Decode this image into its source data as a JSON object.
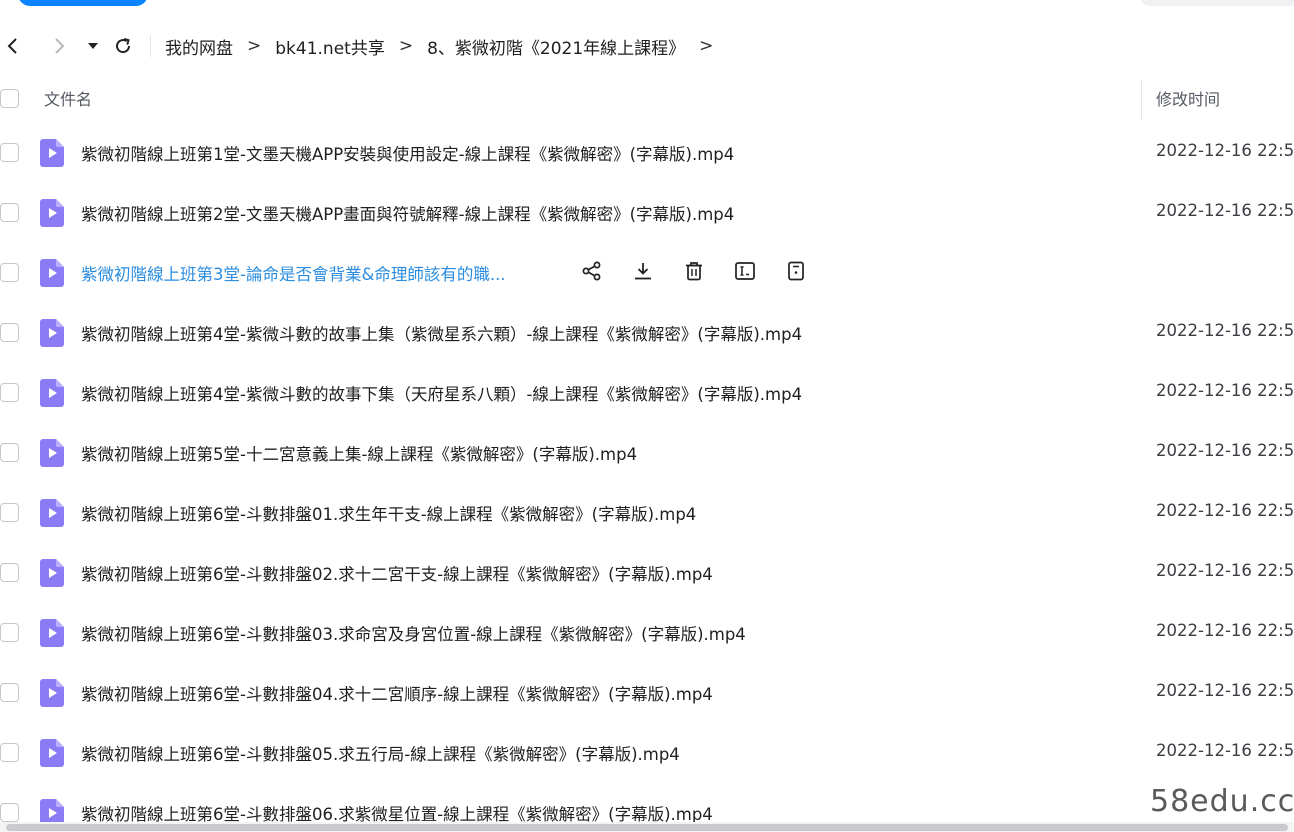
{
  "navigation": {
    "back_icon": "chevron-left-icon",
    "forward_icon": "chevron-right-icon",
    "history_icon": "caret-down-icon",
    "refresh_icon": "refresh-icon",
    "breadcrumbs": [
      "我的网盘",
      "bk41.net共享",
      "8、紫微初階《2021年線上課程》"
    ],
    "separator": ">"
  },
  "table": {
    "column_name": "文件名",
    "column_modified": "修改时间",
    "rows": [
      {
        "name": "紫微初階線上班第1堂-文墨天機APP安裝與使用設定-線上課程《紫微解密》(字幕版).mp4",
        "modified": "2022-12-16 22:5"
      },
      {
        "name": "紫微初階線上班第2堂-文墨天機APP畫面與符號解釋-線上課程《紫微解密》(字幕版).mp4",
        "modified": "2022-12-16 22:5"
      },
      {
        "name": "紫微初階線上班第3堂-論命是否會背業&命理師該有的職...",
        "modified": "",
        "hover": true
      },
      {
        "name": "紫微初階線上班第4堂-紫微斗數的故事上集（紫微星系六顆）-線上課程《紫微解密》(字幕版).mp4",
        "modified": "2022-12-16 22:5"
      },
      {
        "name": "紫微初階線上班第4堂-紫微斗數的故事下集（天府星系八顆）-線上課程《紫微解密》(字幕版).mp4",
        "modified": "2022-12-16 22:5"
      },
      {
        "name": "紫微初階線上班第5堂-十二宮意義上集-線上課程《紫微解密》(字幕版).mp4",
        "modified": "2022-12-16 22:5"
      },
      {
        "name": "紫微初階線上班第6堂-斗數排盤01.求生年干支-線上課程《紫微解密》(字幕版).mp4",
        "modified": "2022-12-16 22:5"
      },
      {
        "name": "紫微初階線上班第6堂-斗數排盤02.求十二宮干支-線上課程《紫微解密》(字幕版).mp4",
        "modified": "2022-12-16 22:5"
      },
      {
        "name": "紫微初階線上班第6堂-斗數排盤03.求命宮及身宮位置-線上課程《紫微解密》(字幕版).mp4",
        "modified": "2022-12-16 22:5"
      },
      {
        "name": "紫微初階線上班第6堂-斗數排盤04.求十二宮順序-線上課程《紫微解密》(字幕版).mp4",
        "modified": "2022-12-16 22:5"
      },
      {
        "name": "紫微初階線上班第6堂-斗數排盤05.求五行局-線上課程《紫微解密》(字幕版).mp4",
        "modified": "2022-12-16 22:5"
      },
      {
        "name": "紫微初階線上班第6堂-斗數排盤06.求紫微星位置-線上課程《紫微解密》(字幕版).mp4",
        "modified": ""
      }
    ],
    "row_actions": [
      "share-icon",
      "download-icon",
      "delete-icon",
      "rename-icon",
      "more-info-icon"
    ]
  },
  "watermark": "58edu.cc",
  "colors": {
    "accent": "#2b8de0",
    "video_icon": "#8b7cf6"
  }
}
